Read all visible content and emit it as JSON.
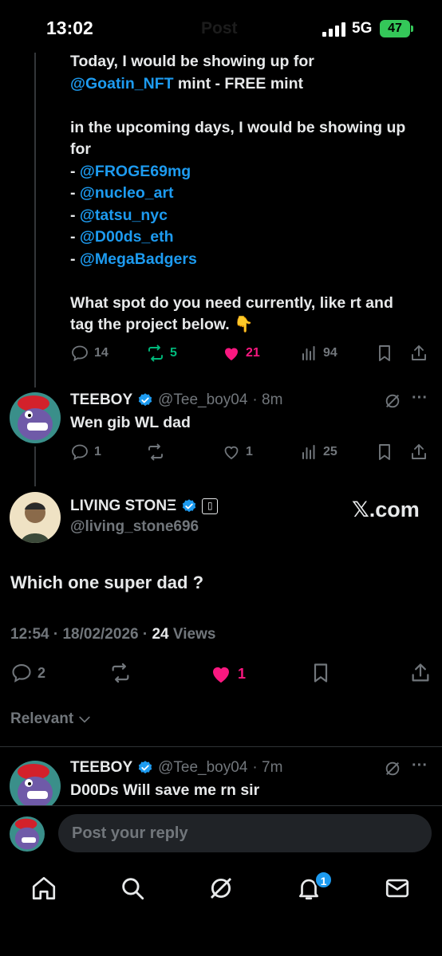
{
  "status_bar": {
    "time": "13:02",
    "ghost_title": "Post",
    "network": "5G",
    "battery": "47"
  },
  "main_tweet": {
    "lines": [
      [
        {
          "t": "Today, I would be showing up for",
          "c": "text"
        }
      ],
      [
        {
          "t": "@Goatin_NFT",
          "c": "link"
        },
        {
          "t": " mint - FREE mint",
          "c": "text"
        }
      ],
      [],
      [
        {
          "t": "in the upcoming days, I would be showing up",
          "c": "text"
        }
      ],
      [
        {
          "t": "for",
          "c": "text"
        }
      ],
      [
        {
          "t": "- ",
          "c": "text"
        },
        {
          "t": "@FROGE69mg",
          "c": "link"
        }
      ],
      [
        {
          "t": "- ",
          "c": "text"
        },
        {
          "t": "@nucleo_art",
          "c": "link"
        }
      ],
      [
        {
          "t": "- ",
          "c": "text"
        },
        {
          "t": "@tatsu_nyc",
          "c": "link"
        }
      ],
      [
        {
          "t": "- ",
          "c": "text"
        },
        {
          "t": "@D00ds_eth",
          "c": "link"
        }
      ],
      [
        {
          "t": "- ",
          "c": "text"
        },
        {
          "t": "@MegaBadgers",
          "c": "link"
        }
      ],
      [],
      [
        {
          "t": "What spot do you need currently, like rt and",
          "c": "text"
        }
      ],
      [
        {
          "t": "tag the project below.  👇",
          "c": "text"
        }
      ]
    ],
    "replies": "14",
    "reposts": "5",
    "likes": "21",
    "views": "94"
  },
  "reply1": {
    "name": "TEEBOY",
    "handle": "@Tee_boy04",
    "time": "· 8m",
    "text": "Wen gib WL dad",
    "replies": "1",
    "reposts": "",
    "likes": "1",
    "views": "25"
  },
  "focal": {
    "name": "LIVING STONΞ",
    "handle": "@living_stone696",
    "badge": "▯",
    "source": "𝕏.com",
    "text": "Which one super dad ?",
    "timestamp": "12:54 · 18/02/2026 · ",
    "views_count": "24",
    "views_label": " Views",
    "replies": "2",
    "likes": "1"
  },
  "sort": {
    "label": "Relevant"
  },
  "reply2": {
    "name": "TEEBOY",
    "handle": "@Tee_boy04",
    "time": "· 7m",
    "text": "D00Ds Will save me rn sir"
  },
  "composer": {
    "placeholder": "Post your reply"
  },
  "nav": {
    "notifications_count": "1"
  },
  "colors": {
    "accent": "#1d9bf0",
    "like": "#f91880",
    "repost": "#00ba7c",
    "muted": "#71767b"
  }
}
